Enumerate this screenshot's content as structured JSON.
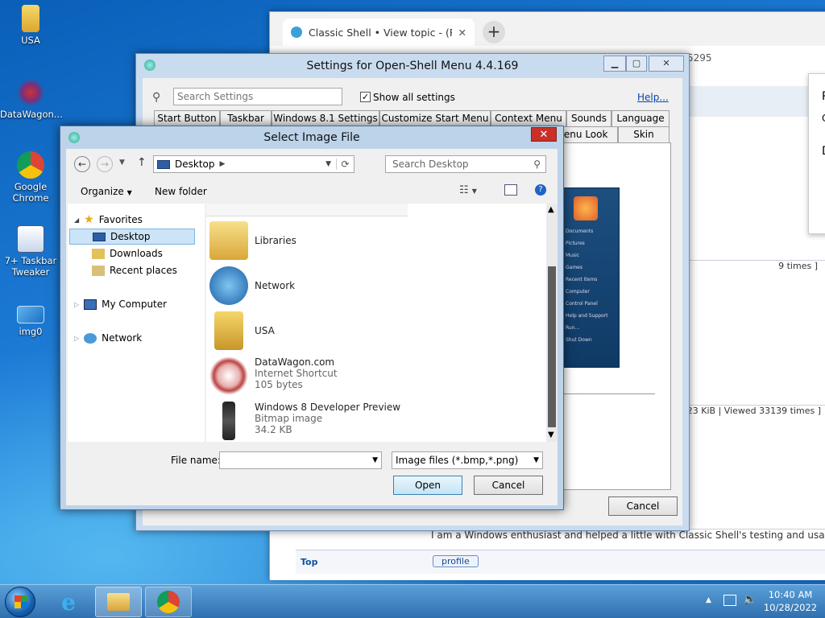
{
  "desktop": {
    "icons": [
      {
        "label": "USA"
      },
      {
        "label": "DataWagon..."
      },
      {
        "label": "Google Chrome"
      },
      {
        "label": "7+ Taskbar Tweaker"
      },
      {
        "label": "img0"
      }
    ]
  },
  "browser": {
    "tab_title": "Classic Shell • View topic - (Requ",
    "url_fragment": "5295",
    "popup_letters": [
      "R",
      "C",
      "D"
    ],
    "row_views_1": "9 times ]",
    "row_views_2": ".23 KiB | Viewed 33139 times ]",
    "signature": "I am a Windows enthusiast and helped a little with Classic Shell's testing and usabi",
    "top_link": "Top",
    "profile_button": "profile"
  },
  "settings": {
    "title": "Settings for Open-Shell Menu 4.4.169",
    "search_placeholder": "Search Settings",
    "show_all_label": "Show all settings",
    "help_link": "Help...",
    "tabs_row1": [
      "Start Button",
      "Taskbar",
      "Windows 8.1 Settings",
      "Customize Start Menu",
      "Context Menu",
      "Sounds",
      "Language"
    ],
    "tabs_row2": [
      "Menu Look",
      "Skin"
    ],
    "cancel_label": "Cancel",
    "preview_menu": [
      "Documents",
      "Pictures",
      "Music",
      "Games",
      "Recent Items",
      "Computer",
      "Control Panel",
      "Help and Support",
      "Run...",
      "Shut Down"
    ]
  },
  "dialog": {
    "title": "Select Image File",
    "address": "Desktop",
    "search_placeholder": "Search Desktop",
    "organize_label": "Organize",
    "new_folder_label": "New folder",
    "nav": {
      "favorites": "Favorites",
      "desktop": "Desktop",
      "downloads": "Downloads",
      "recent": "Recent places",
      "computer": "My Computer",
      "network": "Network"
    },
    "files": [
      {
        "name": "Libraries",
        "type": "",
        "size": ""
      },
      {
        "name": "Network",
        "type": "",
        "size": ""
      },
      {
        "name": "USA",
        "type": "",
        "size": ""
      },
      {
        "name": "DataWagon.com",
        "type": "Internet Shortcut",
        "size": "105 bytes"
      },
      {
        "name": "Windows 8 Developer Preview",
        "type": "Bitmap image",
        "size": "34.2 KB"
      }
    ],
    "filename_label": "File name:",
    "filename_value": "",
    "filetype_value": "Image files (*.bmp,*.png)",
    "open_label": "Open",
    "cancel_label": "Cancel"
  },
  "taskbar": {
    "time": "10:40 AM",
    "date": "10/28/2022"
  }
}
